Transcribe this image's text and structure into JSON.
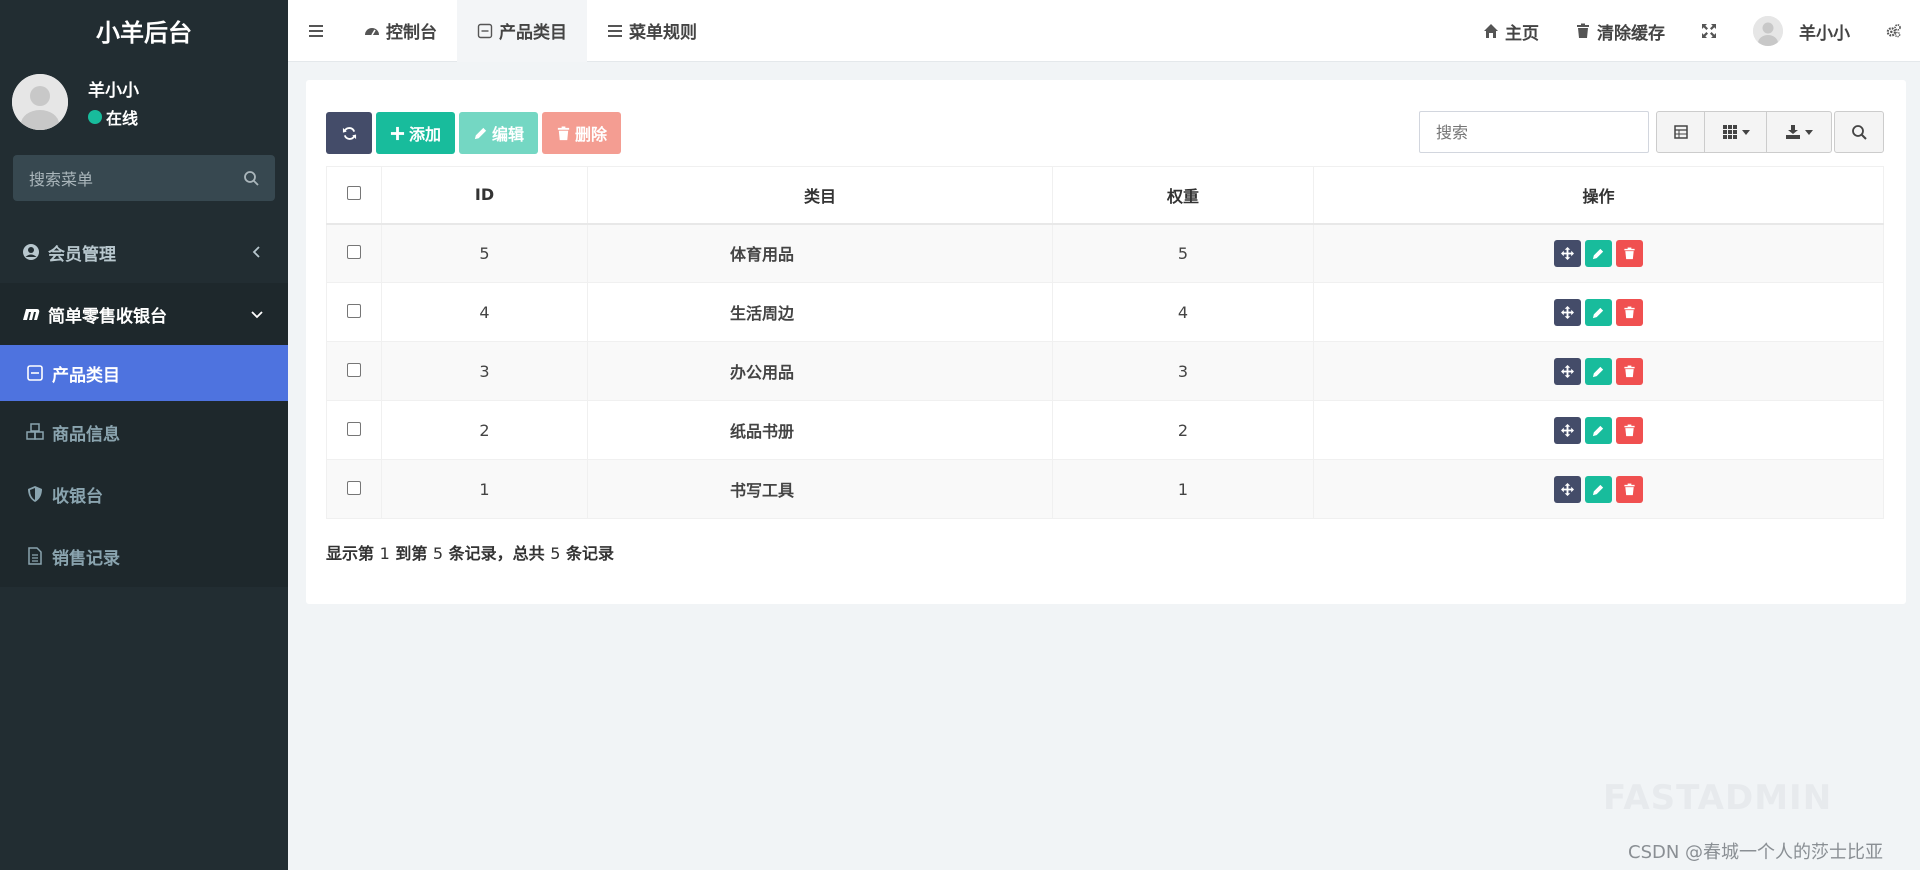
{
  "app": {
    "title": "小羊后台"
  },
  "user": {
    "name": "羊小小",
    "status": "在线"
  },
  "sidebar": {
    "search_placeholder": "搜索菜单",
    "items": [
      {
        "label": "会员管理",
        "icon": "user-circle-icon"
      },
      {
        "label": "简单零售收银台",
        "icon": "maxcdn-icon"
      }
    ],
    "sub_items": [
      {
        "label": "产品类目",
        "icon": "minus-square-icon",
        "active": true
      },
      {
        "label": "商品信息",
        "icon": "cubes-icon"
      },
      {
        "label": "收银台",
        "icon": "shield-icon"
      },
      {
        "label": "销售记录",
        "icon": "file-text-icon"
      }
    ]
  },
  "topbar": {
    "tabs": [
      {
        "label": "控制台",
        "icon": "dashboard-icon"
      },
      {
        "label": "产品类目",
        "icon": "minus-square-icon",
        "active": true
      },
      {
        "label": "菜单规则",
        "icon": "bars-icon"
      }
    ],
    "home": "主页",
    "clear_cache": "清除缓存",
    "user_name": "羊小小"
  },
  "toolbar": {
    "add": "添加",
    "edit": "编辑",
    "delete": "删除",
    "search_placeholder": "搜索"
  },
  "table": {
    "headers": {
      "id": "ID",
      "category": "类目",
      "weight": "权重",
      "actions": "操作"
    },
    "rows": [
      {
        "id": "5",
        "name": "体育用品",
        "weight": "5"
      },
      {
        "id": "4",
        "name": "生活周边",
        "weight": "4"
      },
      {
        "id": "3",
        "name": "办公用品",
        "weight": "3"
      },
      {
        "id": "2",
        "name": "纸品书册",
        "weight": "2"
      },
      {
        "id": "1",
        "name": "书写工具",
        "weight": "1"
      }
    ]
  },
  "pager": {
    "p1": "显示第 ",
    "from": "1",
    "p2": " 到第 ",
    "to": "5",
    "p3": " 条记录，总共 ",
    "total": "5",
    "p4": " 条记录"
  },
  "watermark": {
    "logo": "FASTADMIN",
    "csdn": "CSDN @春城一个人的莎士比亚"
  },
  "colors": {
    "sidebar": "#222d32",
    "active": "#4e73df",
    "primary": "#444c69",
    "success": "#18bc9c",
    "danger": "#f05050"
  }
}
